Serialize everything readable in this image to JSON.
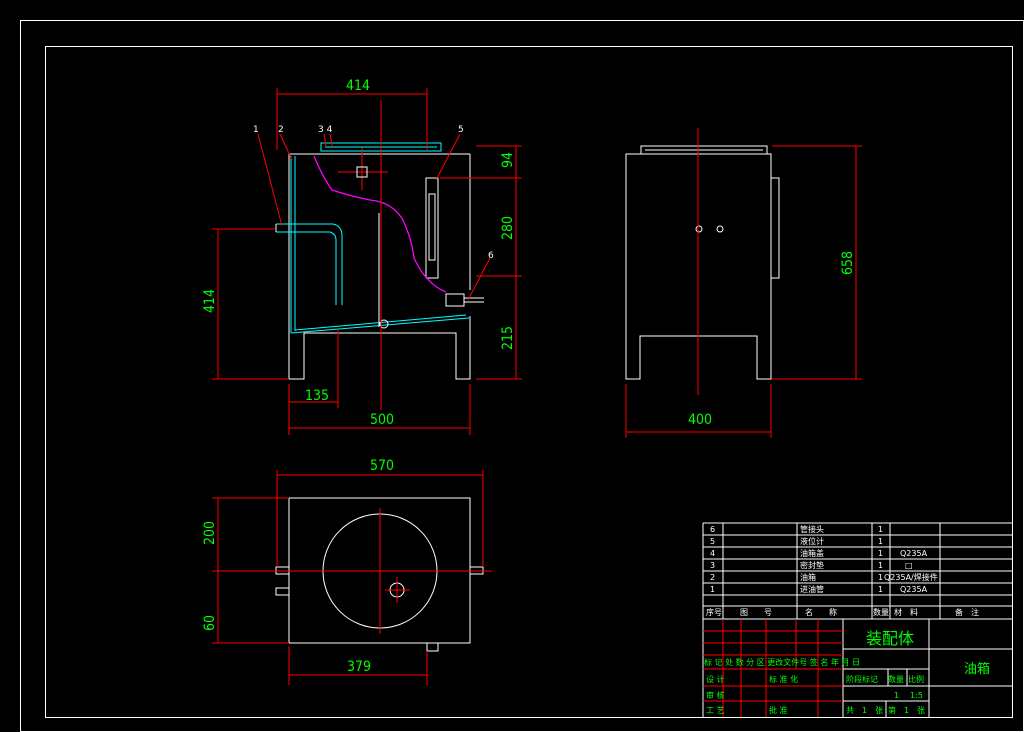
{
  "drawing": {
    "front_view": {
      "dims": {
        "top_width": "414",
        "left_height": "414",
        "offset": "135",
        "width": "500",
        "h94": "94",
        "h280": "280",
        "h215": "215"
      },
      "balloons": [
        "1",
        "2",
        "3 4",
        "5",
        "6"
      ]
    },
    "side_view": {
      "dims": {
        "height": "658",
        "width": "400"
      }
    },
    "top_view": {
      "dims": {
        "width": "570",
        "h200": "200",
        "h60": "60",
        "w379": "379"
      }
    }
  },
  "title_block": {
    "parts": [
      {
        "no": "6",
        "name": "管接头",
        "qty": "1",
        "material": ""
      },
      {
        "no": "5",
        "name": "液位计",
        "qty": "1",
        "material": ""
      },
      {
        "no": "4",
        "name": "油箱盖",
        "qty": "1",
        "material": "Q235A"
      },
      {
        "no": "3",
        "name": "密封垫",
        "qty": "1",
        "material": "□"
      },
      {
        "no": "2",
        "name": "油箱",
        "qty": "1",
        "material": "Q235A/焊接件"
      },
      {
        "no": "1",
        "name": "进油管",
        "qty": "1",
        "material": "Q235A"
      }
    ],
    "header": {
      "no": "序号",
      "drawing_no": "图　　号",
      "name": "名　　称",
      "qty": "数量",
      "material": "材　料",
      "remark": "备　注"
    },
    "assembly_label": "装配体",
    "part_name": "油箱",
    "stage_label": "阶段标记",
    "weight_label": "数量",
    "scale_label": "比例",
    "qty_value": "1",
    "scale_value": "1:5",
    "sheet_total": "共　1　张",
    "sheet_no": "第　1　张",
    "rev_row": "标 记 处 数 分 区 更改文件号 签 名 年 月 日",
    "design": "设 计",
    "review": "审 核",
    "craft": "工 艺",
    "std": "标 准 化",
    "approve": "批 准"
  }
}
